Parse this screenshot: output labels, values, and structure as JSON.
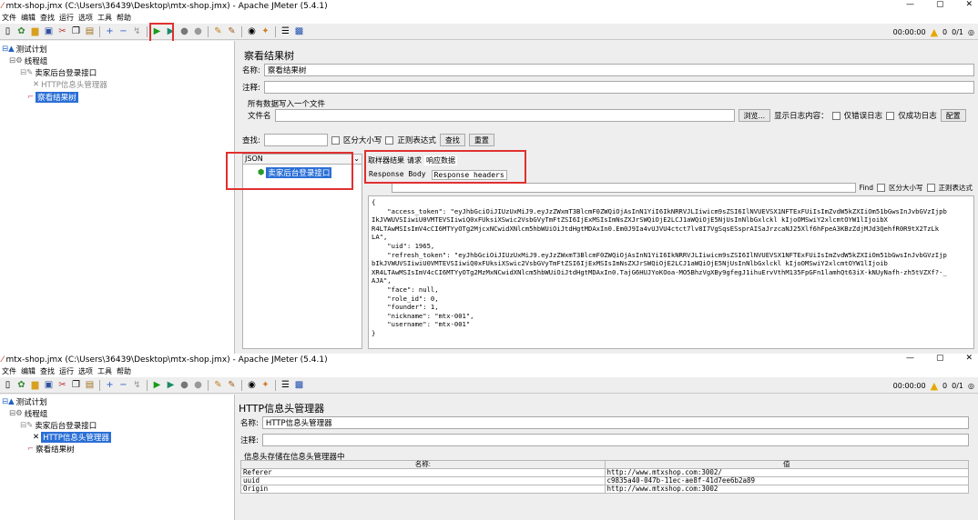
{
  "w1": {
    "title": "mtx-shop.jmx (C:\\Users\\36439\\Desktop\\mtx-shop.jmx) - Apache JMeter (5.4.1)",
    "menu": [
      "文件",
      "编辑",
      "查找",
      "运行",
      "选项",
      "工具",
      "帮助"
    ],
    "timer": "00:00:00",
    "warn_count": "0",
    "threads": "0/1",
    "tree": {
      "plan": "测试计划",
      "group": "线程组",
      "sampler": "卖家后台登录接口",
      "header_mgr": "HTTP信息头管理器",
      "view_tree": "察看结果树"
    },
    "panel": {
      "heading": "察看结果树",
      "name_label": "名称:",
      "name_value": "察看结果树",
      "comment_label": "注释:",
      "file_section": "所有数据写入一个文件",
      "file_label": "文件名",
      "browse": "浏览...",
      "log_label": "显示日志内容：",
      "err_only": "仅错误日志",
      "success_only": "仅成功日志",
      "configure": "配置"
    },
    "search": {
      "label": "查找:",
      "case": "区分大小写",
      "regex": "正则表达式",
      "find": "查找",
      "reset": "重置"
    },
    "renderer": "JSON",
    "result_item": "卖家后台登录接口",
    "tabs": [
      "取样器结果",
      "请求",
      "响应数据"
    ],
    "subtabs": [
      "Response Body",
      "Response headers"
    ],
    "find2": {
      "label": "Find",
      "case": "区分大小写",
      "regex": "正则表达式"
    },
    "response": "{\n    \"access_token\": \"eyJhbGciOiJIUzUxMiJ9.eyJzZWxmT3BlcmF0ZWQiOjAsInN1YiI6IkNRRVJLIiwicm9sZSI6IlNVUEVSX1NFTExFUiIsImZvdW5kZXIiOm51bGwsInJvbGVzIjpb\nIkJVWUVSIiwiU0VMTEVSIiwiQ0xFUksiXSwic2VsbGVyTmFtZSI6IjExMSIsImNsZXJrSWQiOjE2LCJ1aWQiOjE5NjUsInNlbGxlckl kIjoOMSwiY2xlcmtOYW1lIjoibX\nR4LTAwMSIsImV4cCI6MTYyOTg2MjcxNCwidXNlcm5hbWUiOiJtdHgtMDAxIn0.Em0J9Ia4vUJVU4ctct7lv8I7VgSqsESsprAISaJrzcaNJ25Xlf6hFpeA3KBzZdjMJd3QehfR0R9tX2TzLk\nLA\",\n    \"uid\": 1965,\n    \"refresh_token\": \"eyJhbGciOiJIUzUxMiJ9.eyJzZWxmT3BlcmF0ZWQiOjAsInN1YiI6IkNRRVJLIiwicm9sZSI6IlNVUEVSX1NFTExFUiIsImZvdW5kZXIiOm51bGwsInJvbGVzIjp\nbIkJVWUVSIiwiU0VMTEVSIiwiQ0xFUksiXSwic2VsbGVyTmFtZSI6IjExMSIsImNsZXJrSWQiOjE2LCJ1aWQiOjE5NjUsInNlbGxlckl kIjoOMSwiY2xlcmtOYW1lIjoib\nXR4LTAwMSIsImV4cCI6MTYyOTg2MzMxNCwidXNlcm5hbWUiOiJtdHgtMDAxIn0.TajG6HUJYoKOoa-MO5BhzVgXBy9gfegJ1ihuErvVthM135FpGFn1lamhQt63iX-kNUyNafh-zh5tVZXf?-_\nAJA\",\n    \"face\": null,\n    \"role_id\": 0,\n    \"founder\": 1,\n    \"nickname\": \"mtx-001\",\n    \"username\": \"mtx-001\"\n}"
  },
  "w2": {
    "title": "mtx-shop.jmx (C:\\Users\\36439\\Desktop\\mtx-shop.jmx) - Apache JMeter (5.4.1)",
    "menu": [
      "文件",
      "编辑",
      "查找",
      "运行",
      "选项",
      "工具",
      "帮助"
    ],
    "timer": "00:00:00",
    "warn_count": "0",
    "threads": "0/1",
    "tree": {
      "plan": "测试计划",
      "group": "线程组",
      "sampler": "卖家后台登录接口",
      "header_mgr": "HTTP信息头管理器",
      "view_tree": "察看结果树"
    },
    "panel": {
      "heading": "HTTP信息头管理器",
      "name_label": "名称:",
      "name_value": "HTTP信息头管理器",
      "comment_label": "注释:",
      "stored": "信息头存储在信息头管理器中"
    },
    "headers": {
      "col_name": "名称:",
      "col_value": "值",
      "rows": [
        {
          "name": "Referer",
          "value": "http://www.mtxshop.com:3002/"
        },
        {
          "name": "uuid",
          "value": "c9835a40-047b-11ec-ae8f-41d7ee6b2a89"
        },
        {
          "name": "Origin",
          "value": "http://www.mtxshop.com:3002"
        }
      ]
    }
  }
}
